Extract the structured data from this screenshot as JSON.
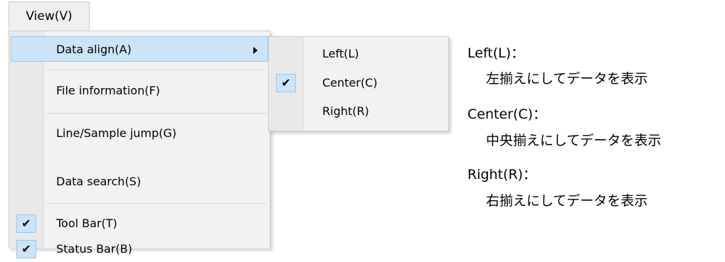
{
  "menubar": {
    "view_label": "View(V)"
  },
  "view_menu": {
    "items": [
      {
        "label": "Data align(A)",
        "checked": false,
        "highlighted": true,
        "has_submenu": true
      },
      {
        "label": "File information(F)",
        "checked": false
      },
      {
        "label": "Line/Sample jump(G)",
        "checked": false
      },
      {
        "label": "Data search(S)",
        "checked": false
      },
      {
        "label": "Tool Bar(T)",
        "checked": true
      },
      {
        "label": "Status Bar(B)",
        "checked": true
      }
    ],
    "check_glyph": "✔",
    "submenu_arrow_icon": "triangle-right"
  },
  "align_submenu": {
    "items": [
      {
        "label": "Left(L)",
        "checked": false
      },
      {
        "label": "Center(C)",
        "checked": true
      },
      {
        "label": "Right(R)",
        "checked": false
      }
    ]
  },
  "descriptions": [
    {
      "title": "Left(L)：",
      "text": "左揃えにしてデータを表示"
    },
    {
      "title": "Center(C)：",
      "text": "中央揃えにしてデータを表示"
    },
    {
      "title": "Right(R)：",
      "text": "右揃えにしてデータを表示"
    }
  ],
  "colors": {
    "highlight_fill": "#cce4f7",
    "highlight_border": "#99c9ef",
    "menu_background": "#f2f2f2",
    "menu_border": "#cccccc"
  }
}
